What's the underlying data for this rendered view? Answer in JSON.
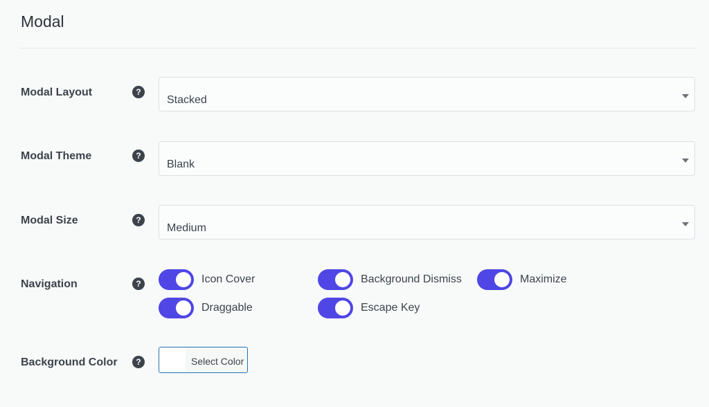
{
  "section": {
    "title": "Modal"
  },
  "fields": {
    "layout": {
      "label": "Modal Layout",
      "value": "Stacked"
    },
    "theme": {
      "label": "Modal Theme",
      "value": "Blank"
    },
    "size": {
      "label": "Modal Size",
      "value": "Medium"
    },
    "navigation": {
      "label": "Navigation",
      "toggles": [
        {
          "label": "Icon Cover",
          "on": true
        },
        {
          "label": "Background Dismiss",
          "on": true
        },
        {
          "label": "Maximize",
          "on": true
        },
        {
          "label": "Draggable",
          "on": true
        },
        {
          "label": "Escape Key",
          "on": true
        }
      ]
    },
    "background": {
      "label": "Background Color",
      "button": "Select Color"
    }
  },
  "help_glyph": "?",
  "colors": {
    "accent": "#4f46e5",
    "border": "#dcdfe3",
    "button_border": "#2271b1"
  },
  "icons": {
    "help": "question-circle-icon",
    "caret": "caret-down-icon"
  }
}
